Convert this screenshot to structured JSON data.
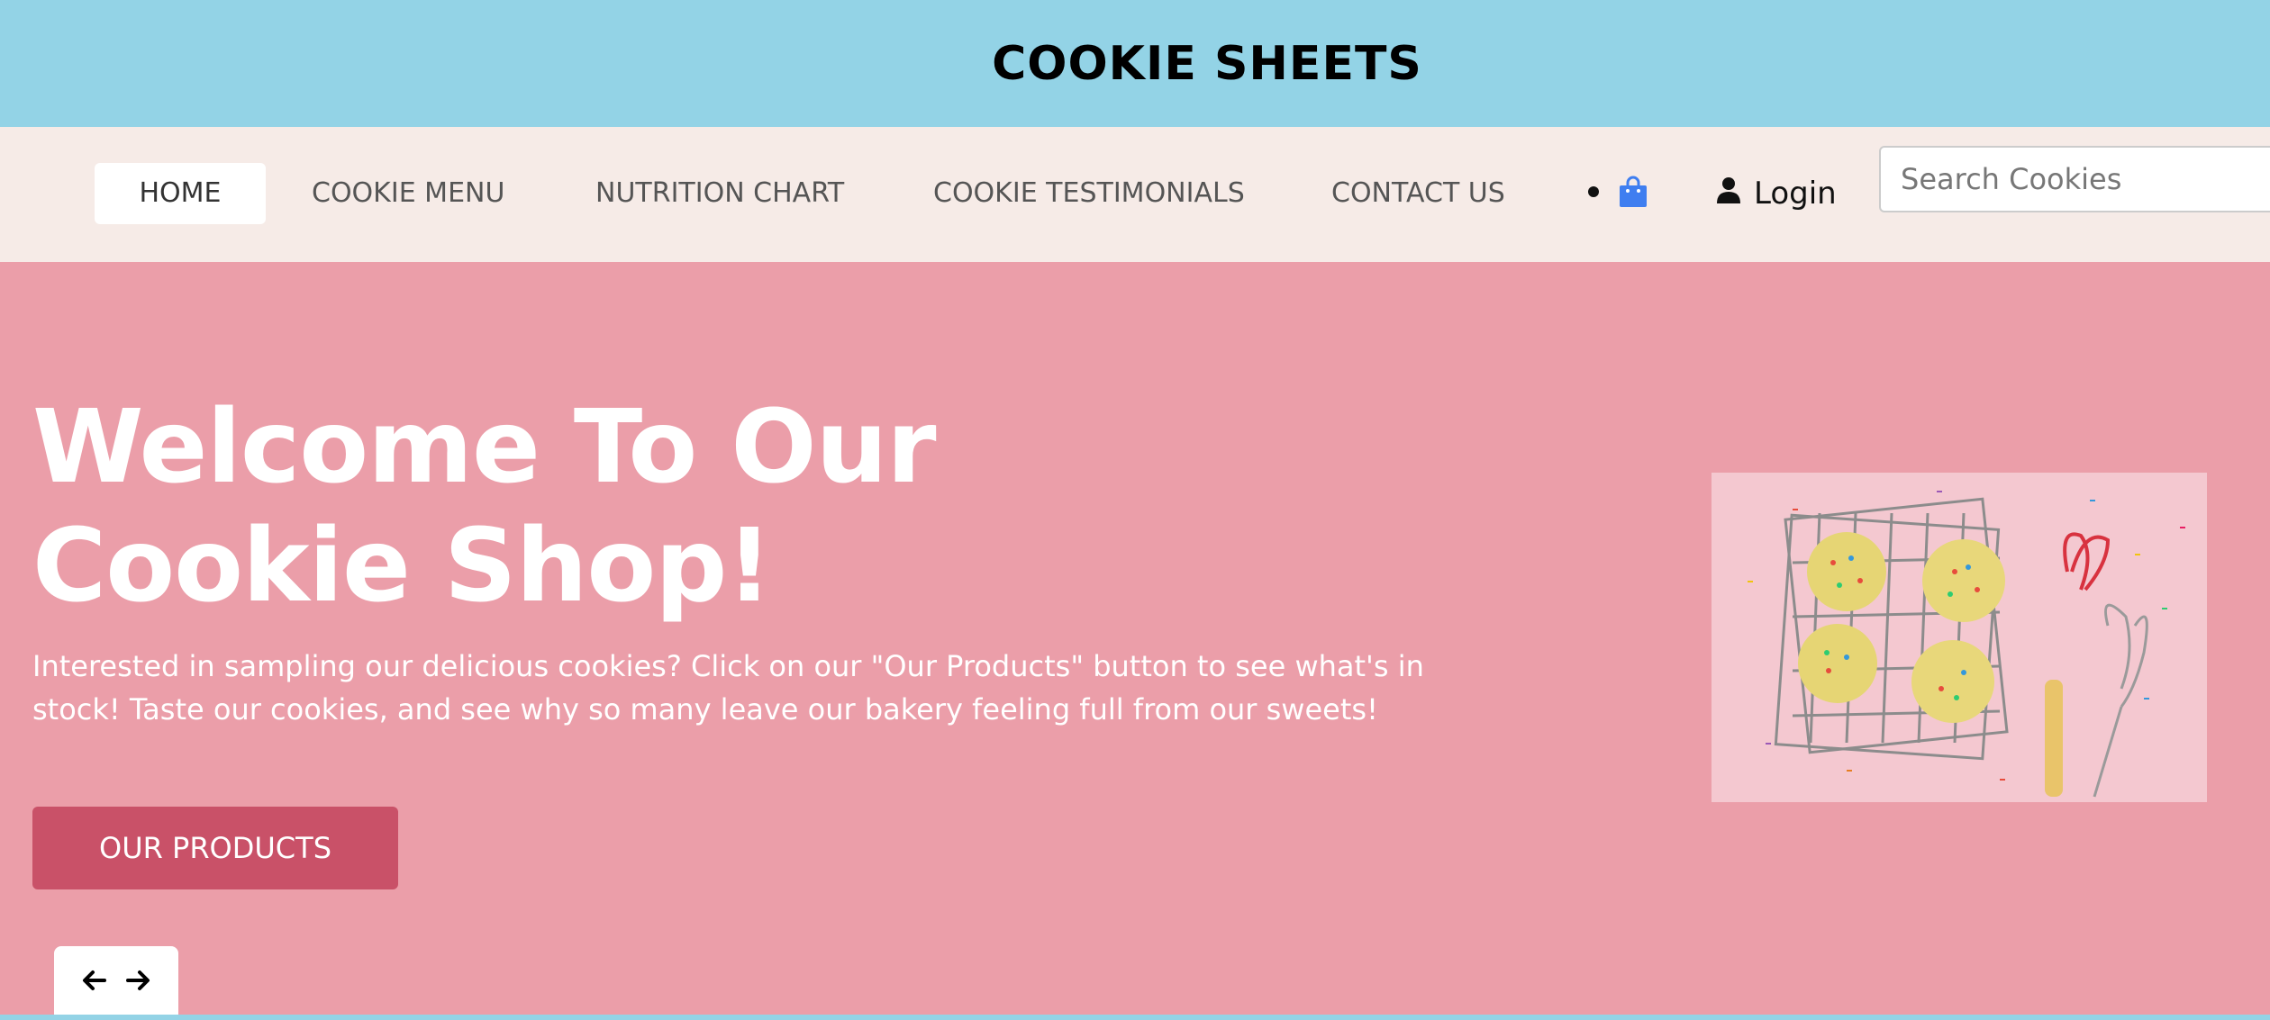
{
  "brand": {
    "title": "COOKIE SHEETS"
  },
  "nav": {
    "items": [
      {
        "label": "HOME"
      },
      {
        "label": "COOKIE MENU"
      },
      {
        "label": "NUTRITION CHART"
      },
      {
        "label": "COOKIE TESTIMONIALS"
      },
      {
        "label": "CONTACT US"
      }
    ],
    "cart_icon": "shopping-bag-icon",
    "login_label": "Login",
    "user_icon": "user-icon",
    "search_placeholder": "Search Cookies"
  },
  "hero": {
    "title_line1": "Welcome To Our",
    "title_line2": "Cookie Shop!",
    "text": "Interested in sampling our delicious cookies? Click on our \"Our Products\" button to see what's in stock! Taste our cookies, and see why so many leave our bakery feeling full from our sweets!",
    "button_label": "OUR PRODUCTS",
    "prev_icon": "arrow-left-icon",
    "next_icon": "arrow-right-icon"
  },
  "colors": {
    "header_bg": "#93d3e6",
    "nav_bg": "#f6ebe7",
    "hero_bg": "#eb9ea9",
    "button_bg": "#c95168",
    "cart_icon": "#3f7ef0"
  }
}
